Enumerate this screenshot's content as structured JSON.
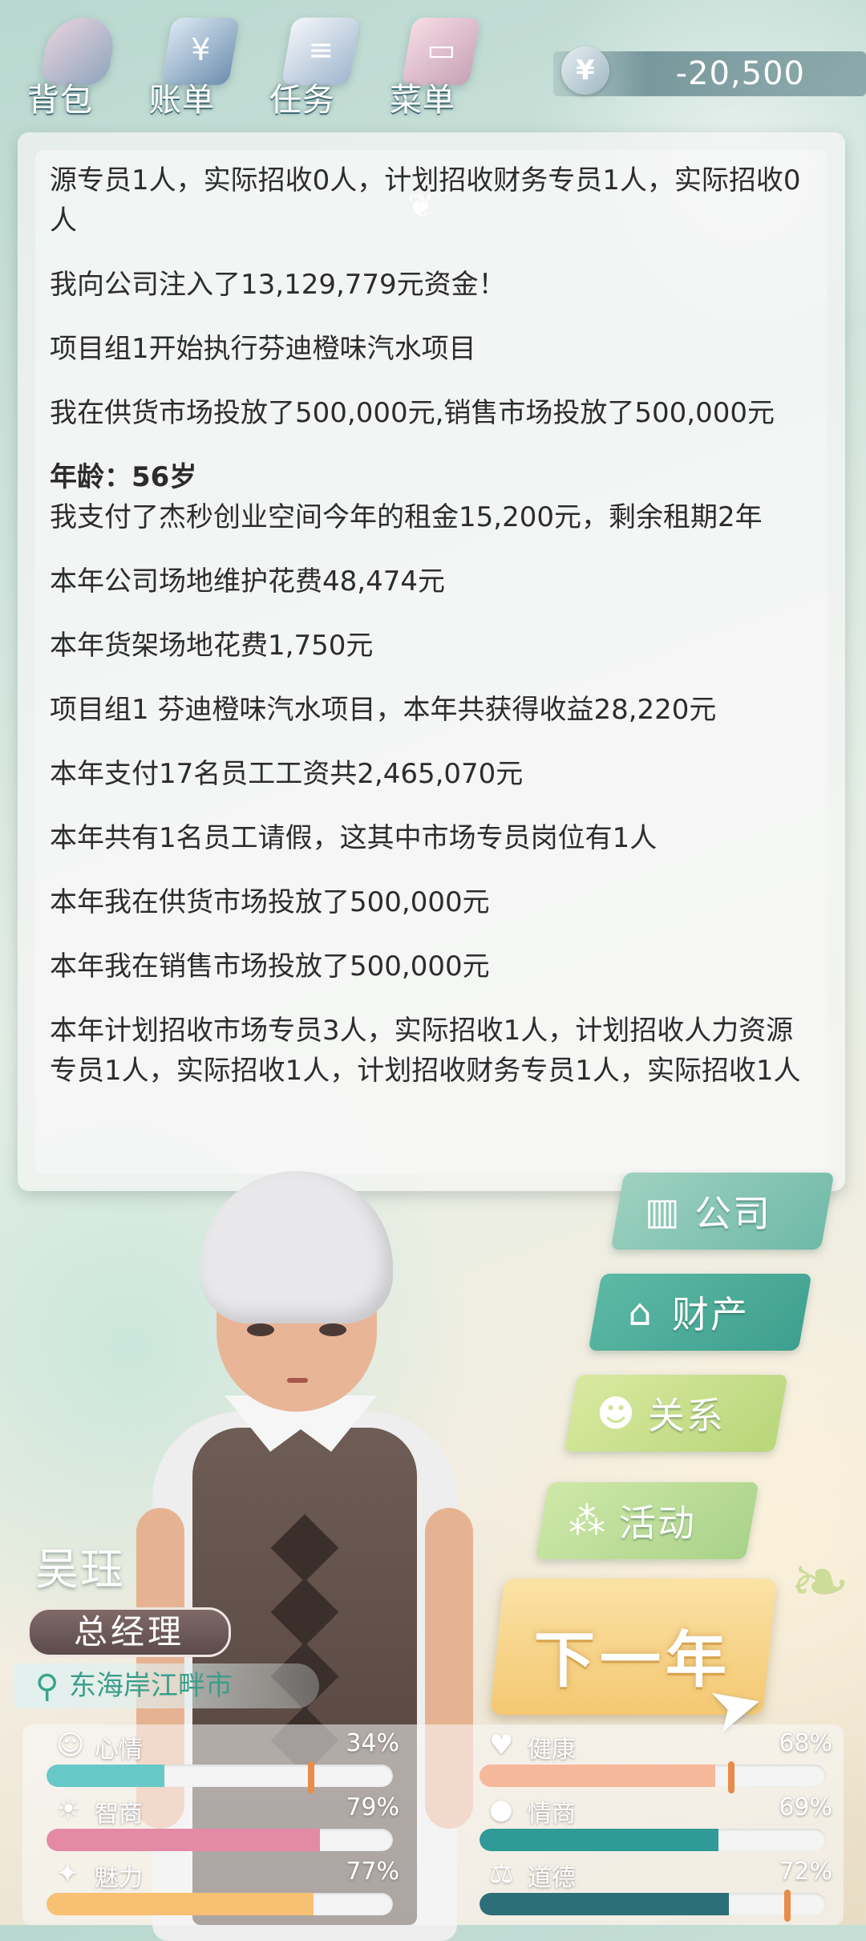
{
  "topbar": {
    "buttons": [
      {
        "label": "背包",
        "icon": "backpack-icon",
        "glyph": ""
      },
      {
        "label": "账单",
        "icon": "bill-icon",
        "glyph": "¥"
      },
      {
        "label": "任务",
        "icon": "task-icon",
        "glyph": "≡"
      },
      {
        "label": "菜单",
        "icon": "menu-icon",
        "glyph": "▭"
      }
    ],
    "money": {
      "symbol": "¥",
      "value": "-20,500"
    }
  },
  "log": [
    "源专员1人，实际招收0人，计划招收财务专员1人，实际招收0人",
    "我向公司注入了13,129,779元资金！",
    "项目组1开始执行芬迪橙味汽水项目",
    "我在供货市场投放了500,000元,销售市场投放了500,000元"
  ],
  "age_line": "年龄：56岁",
  "log_after_age": [
    "我支付了杰秒创业空间今年的租金15,200元，剩余租期2年",
    "本年公司场地维护花费48,474元",
    "本年货架场地花费1,750元",
    "项目组1 芬迪橙味汽水项目，本年共获得收益28,220元",
    "本年支付17名员工工资共2,465,070元",
    "本年共有1名员工请假，这其中市场专员岗位有1人",
    "本年我在供货市场投放了500,000元",
    "本年我在销售市场投放了500,000元",
    "本年计划招收市场专员3人，实际招收1人，计划招收人力资源专员1人，实际招收1人，计划招收财务专员1人，实际招收1人"
  ],
  "side_menu": {
    "company": "公司",
    "asset": "财产",
    "relation": "关系",
    "activity": "活动"
  },
  "next_year": "下一年",
  "character": {
    "name": "吴珏",
    "title": "总经理",
    "location": "东海岸江畔市"
  },
  "stats": [
    {
      "key": "mood",
      "label": "心情",
      "value": "34%",
      "fraction": 0.34,
      "color": "#67c8c8",
      "icon": "smiley-icon",
      "glyph": "☺"
    },
    {
      "key": "health",
      "label": "健康",
      "value": "68%",
      "fraction": 0.68,
      "color": "#f6b89a",
      "icon": "heart-icon",
      "glyph": "♥"
    },
    {
      "key": "iq",
      "label": "智商",
      "value": "79%",
      "fraction": 0.79,
      "color": "#e48aa6",
      "icon": "bulb-icon",
      "glyph": "☀"
    },
    {
      "key": "eq",
      "label": "情商",
      "value": "69%",
      "fraction": 0.69,
      "color": "#2f9a97",
      "icon": "apple-icon",
      "glyph": "●"
    },
    {
      "key": "charm",
      "label": "魅力",
      "value": "77%",
      "fraction": 0.77,
      "color": "#f7c072",
      "icon": "sparkle-icon",
      "glyph": "✦"
    },
    {
      "key": "moral",
      "label": "道德",
      "value": "72%",
      "fraction": 0.72,
      "color": "#2d6f78",
      "icon": "scale-icon",
      "glyph": "⚖"
    }
  ]
}
